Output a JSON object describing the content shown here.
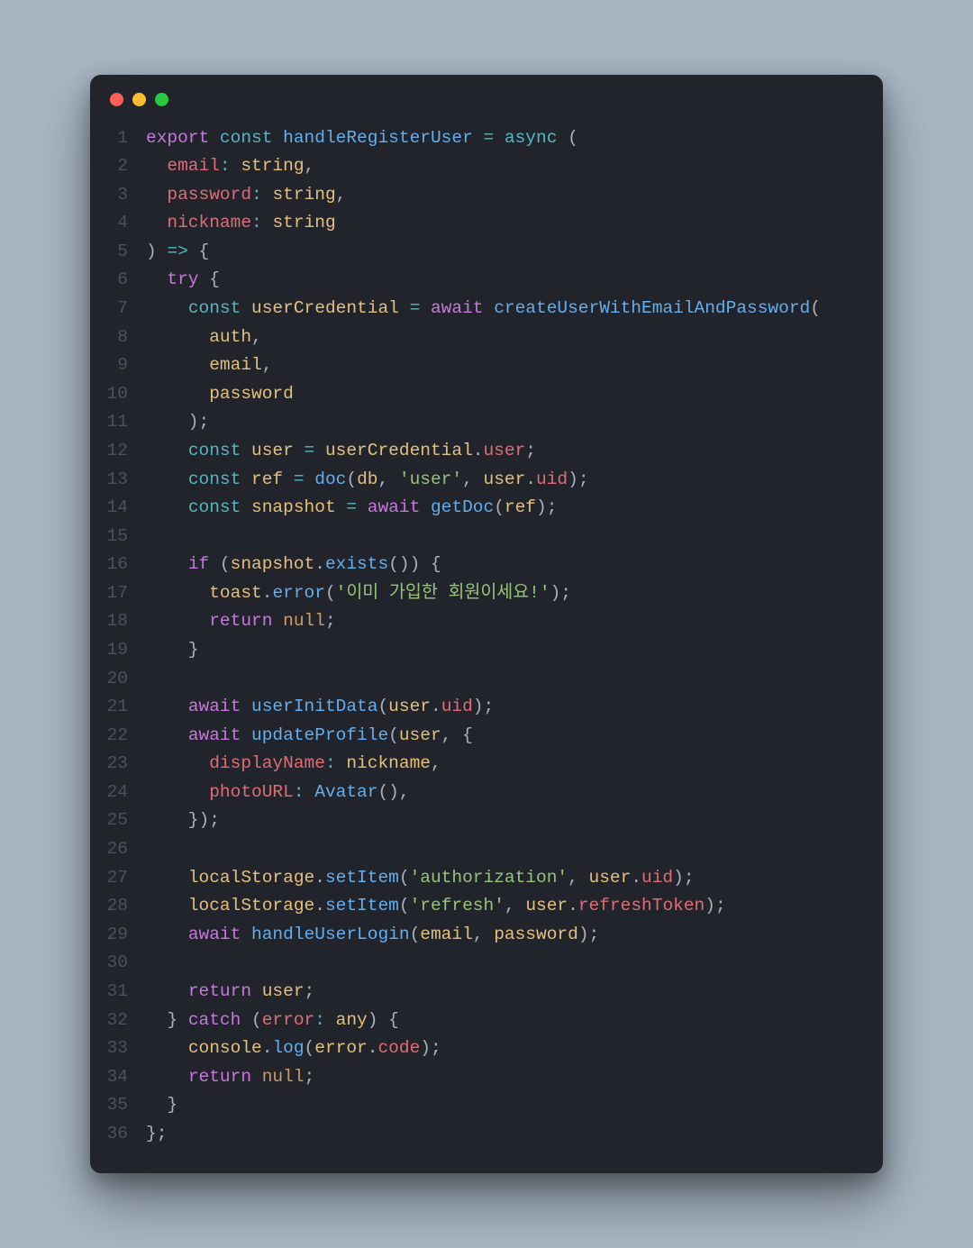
{
  "window": {
    "trafficLights": [
      "close",
      "minimize",
      "zoom"
    ]
  },
  "code": {
    "lineCount": 36,
    "lines": [
      [
        [
          "kw",
          "export"
        ],
        [
          "punct",
          " "
        ],
        [
          "sk",
          "const"
        ],
        [
          "punct",
          " "
        ],
        [
          "fn",
          "handleRegisterUser"
        ],
        [
          "punct",
          " "
        ],
        [
          "sk",
          "="
        ],
        [
          "punct",
          " "
        ],
        [
          "sk",
          "async"
        ],
        [
          "punct",
          " ("
        ]
      ],
      [
        [
          "punct",
          "  "
        ],
        [
          "param",
          "email"
        ],
        [
          "sk",
          ":"
        ],
        [
          "punct",
          " "
        ],
        [
          "type",
          "string"
        ],
        [
          "punct",
          ","
        ]
      ],
      [
        [
          "punct",
          "  "
        ],
        [
          "param",
          "password"
        ],
        [
          "sk",
          ":"
        ],
        [
          "punct",
          " "
        ],
        [
          "type",
          "string"
        ],
        [
          "punct",
          ","
        ]
      ],
      [
        [
          "punct",
          "  "
        ],
        [
          "param",
          "nickname"
        ],
        [
          "sk",
          ":"
        ],
        [
          "punct",
          " "
        ],
        [
          "type",
          "string"
        ]
      ],
      [
        [
          "punct",
          ") "
        ],
        [
          "sk",
          "=>"
        ],
        [
          "punct",
          " {"
        ]
      ],
      [
        [
          "punct",
          "  "
        ],
        [
          "kw",
          "try"
        ],
        [
          "punct",
          " {"
        ]
      ],
      [
        [
          "punct",
          "    "
        ],
        [
          "sk",
          "const"
        ],
        [
          "punct",
          " "
        ],
        [
          "var",
          "userCredential"
        ],
        [
          "punct",
          " "
        ],
        [
          "sk",
          "="
        ],
        [
          "punct",
          " "
        ],
        [
          "kw",
          "await"
        ],
        [
          "punct",
          " "
        ],
        [
          "fn",
          "createUserWithEmailAndPassword"
        ],
        [
          "punct",
          "("
        ]
      ],
      [
        [
          "punct",
          "      "
        ],
        [
          "var",
          "auth"
        ],
        [
          "punct",
          ","
        ]
      ],
      [
        [
          "punct",
          "      "
        ],
        [
          "var",
          "email"
        ],
        [
          "punct",
          ","
        ]
      ],
      [
        [
          "punct",
          "      "
        ],
        [
          "var",
          "password"
        ]
      ],
      [
        [
          "punct",
          "    );"
        ]
      ],
      [
        [
          "punct",
          "    "
        ],
        [
          "sk",
          "const"
        ],
        [
          "punct",
          " "
        ],
        [
          "var",
          "user"
        ],
        [
          "punct",
          " "
        ],
        [
          "sk",
          "="
        ],
        [
          "punct",
          " "
        ],
        [
          "var",
          "userCredential"
        ],
        [
          "punct",
          "."
        ],
        [
          "prop",
          "user"
        ],
        [
          "punct",
          ";"
        ]
      ],
      [
        [
          "punct",
          "    "
        ],
        [
          "sk",
          "const"
        ],
        [
          "punct",
          " "
        ],
        [
          "var",
          "ref"
        ],
        [
          "punct",
          " "
        ],
        [
          "sk",
          "="
        ],
        [
          "punct",
          " "
        ],
        [
          "fn",
          "doc"
        ],
        [
          "punct",
          "("
        ],
        [
          "var",
          "db"
        ],
        [
          "punct",
          ", "
        ],
        [
          "str",
          "'user'"
        ],
        [
          "punct",
          ", "
        ],
        [
          "var",
          "user"
        ],
        [
          "punct",
          "."
        ],
        [
          "prop",
          "uid"
        ],
        [
          "punct",
          ");"
        ]
      ],
      [
        [
          "punct",
          "    "
        ],
        [
          "sk",
          "const"
        ],
        [
          "punct",
          " "
        ],
        [
          "var",
          "snapshot"
        ],
        [
          "punct",
          " "
        ],
        [
          "sk",
          "="
        ],
        [
          "punct",
          " "
        ],
        [
          "kw",
          "await"
        ],
        [
          "punct",
          " "
        ],
        [
          "fn",
          "getDoc"
        ],
        [
          "punct",
          "("
        ],
        [
          "var",
          "ref"
        ],
        [
          "punct",
          ");"
        ]
      ],
      [
        [
          "punct",
          ""
        ]
      ],
      [
        [
          "punct",
          "    "
        ],
        [
          "kw",
          "if"
        ],
        [
          "punct",
          " ("
        ],
        [
          "var",
          "snapshot"
        ],
        [
          "punct",
          "."
        ],
        [
          "fn",
          "exists"
        ],
        [
          "punct",
          "()) {"
        ]
      ],
      [
        [
          "punct",
          "      "
        ],
        [
          "var",
          "toast"
        ],
        [
          "punct",
          "."
        ],
        [
          "fn",
          "error"
        ],
        [
          "punct",
          "("
        ],
        [
          "str",
          "'이미 가입한 회원이세요!'"
        ],
        [
          "punct",
          ");"
        ]
      ],
      [
        [
          "punct",
          "      "
        ],
        [
          "kw",
          "return"
        ],
        [
          "punct",
          " "
        ],
        [
          "const",
          "null"
        ],
        [
          "punct",
          ";"
        ]
      ],
      [
        [
          "punct",
          "    }"
        ]
      ],
      [
        [
          "punct",
          ""
        ]
      ],
      [
        [
          "punct",
          "    "
        ],
        [
          "kw",
          "await"
        ],
        [
          "punct",
          " "
        ],
        [
          "fn",
          "userInitData"
        ],
        [
          "punct",
          "("
        ],
        [
          "var",
          "user"
        ],
        [
          "punct",
          "."
        ],
        [
          "prop",
          "uid"
        ],
        [
          "punct",
          ");"
        ]
      ],
      [
        [
          "punct",
          "    "
        ],
        [
          "kw",
          "await"
        ],
        [
          "punct",
          " "
        ],
        [
          "fn",
          "updateProfile"
        ],
        [
          "punct",
          "("
        ],
        [
          "var",
          "user"
        ],
        [
          "punct",
          ", {"
        ]
      ],
      [
        [
          "punct",
          "      "
        ],
        [
          "prop",
          "displayName"
        ],
        [
          "sk",
          ":"
        ],
        [
          "punct",
          " "
        ],
        [
          "var",
          "nickname"
        ],
        [
          "punct",
          ","
        ]
      ],
      [
        [
          "punct",
          "      "
        ],
        [
          "prop",
          "photoURL"
        ],
        [
          "sk",
          ":"
        ],
        [
          "punct",
          " "
        ],
        [
          "fn",
          "Avatar"
        ],
        [
          "punct",
          "(),"
        ]
      ],
      [
        [
          "punct",
          "    });"
        ]
      ],
      [
        [
          "punct",
          ""
        ]
      ],
      [
        [
          "punct",
          "    "
        ],
        [
          "var",
          "localStorage"
        ],
        [
          "punct",
          "."
        ],
        [
          "fn",
          "setItem"
        ],
        [
          "punct",
          "("
        ],
        [
          "str",
          "'authorization'"
        ],
        [
          "punct",
          ", "
        ],
        [
          "var",
          "user"
        ],
        [
          "punct",
          "."
        ],
        [
          "prop",
          "uid"
        ],
        [
          "punct",
          ");"
        ]
      ],
      [
        [
          "punct",
          "    "
        ],
        [
          "var",
          "localStorage"
        ],
        [
          "punct",
          "."
        ],
        [
          "fn",
          "setItem"
        ],
        [
          "punct",
          "("
        ],
        [
          "str",
          "'refresh'"
        ],
        [
          "punct",
          ", "
        ],
        [
          "var",
          "user"
        ],
        [
          "punct",
          "."
        ],
        [
          "prop",
          "refreshToken"
        ],
        [
          "punct",
          ");"
        ]
      ],
      [
        [
          "punct",
          "    "
        ],
        [
          "kw",
          "await"
        ],
        [
          "punct",
          " "
        ],
        [
          "fn",
          "handleUserLogin"
        ],
        [
          "punct",
          "("
        ],
        [
          "var",
          "email"
        ],
        [
          "punct",
          ", "
        ],
        [
          "var",
          "password"
        ],
        [
          "punct",
          ");"
        ]
      ],
      [
        [
          "punct",
          ""
        ]
      ],
      [
        [
          "punct",
          "    "
        ],
        [
          "kw",
          "return"
        ],
        [
          "punct",
          " "
        ],
        [
          "var",
          "user"
        ],
        [
          "punct",
          ";"
        ]
      ],
      [
        [
          "punct",
          "  } "
        ],
        [
          "kw",
          "catch"
        ],
        [
          "punct",
          " ("
        ],
        [
          "param",
          "error"
        ],
        [
          "sk",
          ":"
        ],
        [
          "punct",
          " "
        ],
        [
          "type",
          "any"
        ],
        [
          "punct",
          ") {"
        ]
      ],
      [
        [
          "punct",
          "    "
        ],
        [
          "var",
          "console"
        ],
        [
          "punct",
          "."
        ],
        [
          "fn",
          "log"
        ],
        [
          "punct",
          "("
        ],
        [
          "var",
          "error"
        ],
        [
          "punct",
          "."
        ],
        [
          "prop",
          "code"
        ],
        [
          "punct",
          ");"
        ]
      ],
      [
        [
          "punct",
          "    "
        ],
        [
          "kw",
          "return"
        ],
        [
          "punct",
          " "
        ],
        [
          "const",
          "null"
        ],
        [
          "punct",
          ";"
        ]
      ],
      [
        [
          "punct",
          "  }"
        ]
      ],
      [
        [
          "punct",
          "};"
        ]
      ]
    ]
  }
}
